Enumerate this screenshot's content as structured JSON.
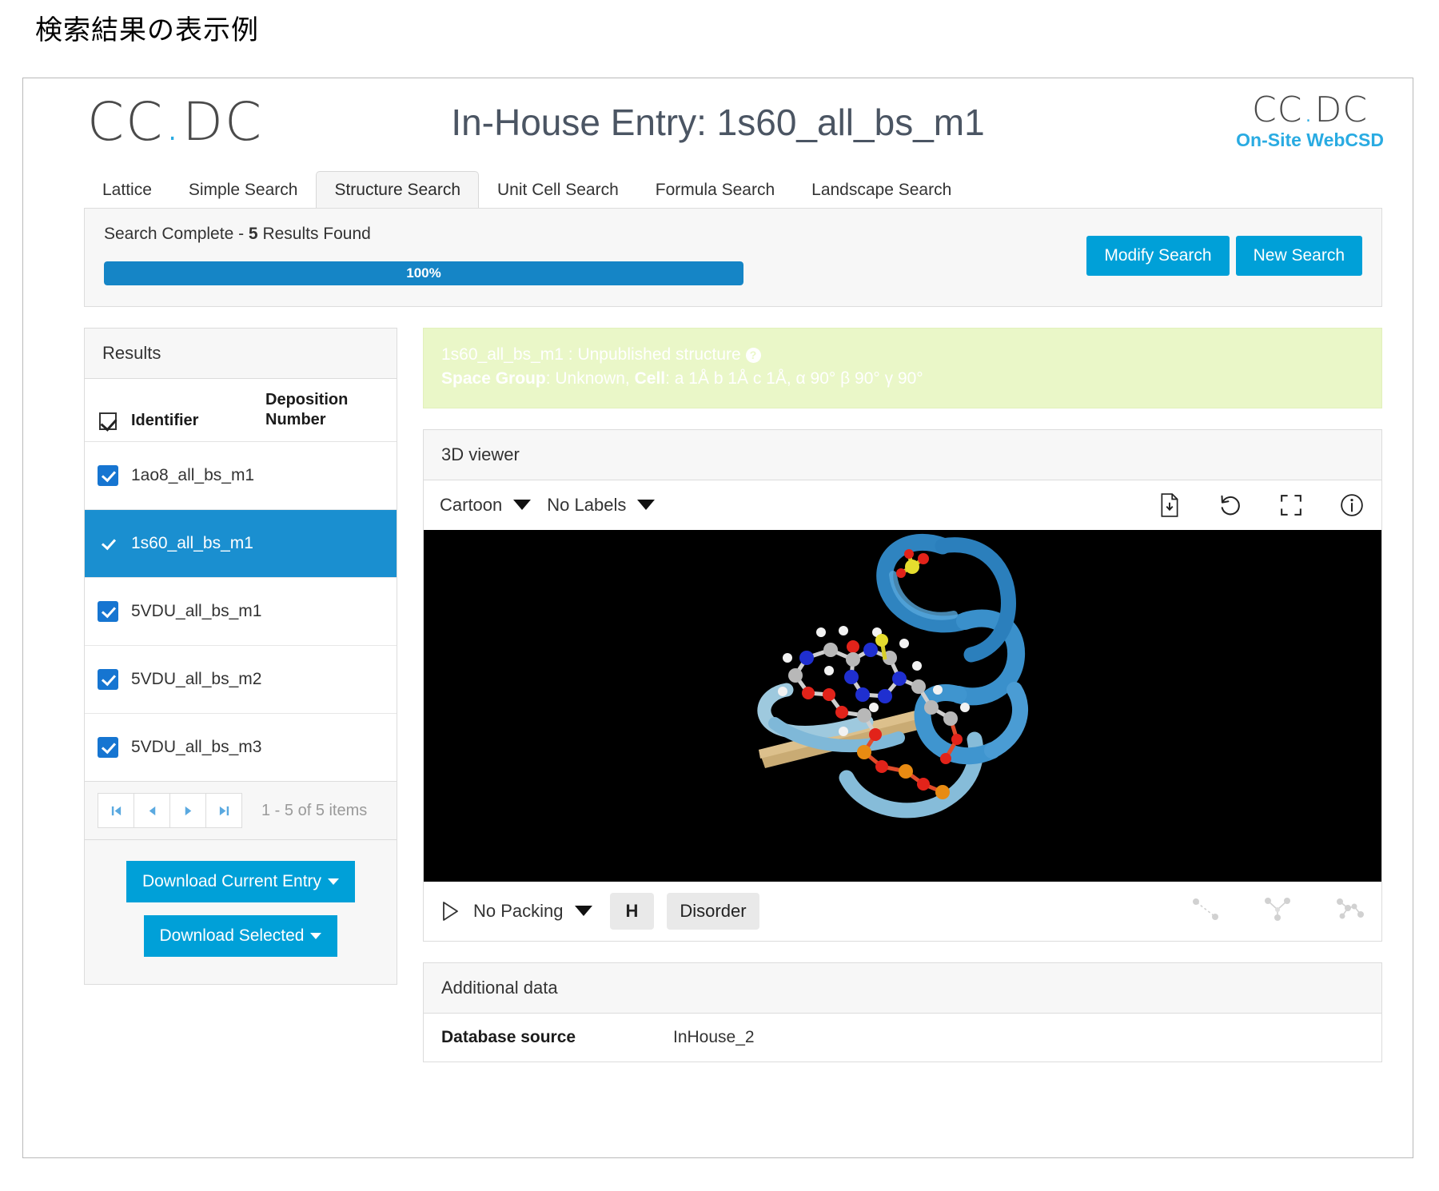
{
  "caption": "検索結果の表示例",
  "header": {
    "logo_left": "CCDC",
    "title": "In-House Entry: 1s60_all_bs_m1",
    "logo_right_top": "CCDC",
    "logo_right_sub": "On-Site WebCSD",
    "accent_color": "#29abe2"
  },
  "tabs": [
    {
      "label": "Lattice",
      "active": false
    },
    {
      "label": "Simple Search",
      "active": false
    },
    {
      "label": "Structure Search",
      "active": true
    },
    {
      "label": "Unit Cell Search",
      "active": false
    },
    {
      "label": "Formula Search",
      "active": false
    },
    {
      "label": "Landscape Search",
      "active": false
    }
  ],
  "status": {
    "prefix": "Search Complete - ",
    "count": "5",
    "suffix": " Results Found",
    "progress_label": "100%",
    "progress_percent": 100,
    "modify_button": "Modify Search",
    "new_button": "New Search",
    "button_color": "#00a0d8",
    "progress_color": "#1585c6"
  },
  "results": {
    "panel_title": "Results",
    "columns": [
      "Identifier",
      "Deposition Number"
    ],
    "rows": [
      {
        "identifier": "1ao8_all_bs_m1",
        "deposition": "",
        "checked": true,
        "selected": false
      },
      {
        "identifier": "1s60_all_bs_m1",
        "deposition": "",
        "checked": true,
        "selected": true
      },
      {
        "identifier": "5VDU_all_bs_m1",
        "deposition": "",
        "checked": true,
        "selected": false
      },
      {
        "identifier": "5VDU_all_bs_m2",
        "deposition": "",
        "checked": true,
        "selected": false
      },
      {
        "identifier": "5VDU_all_bs_m3",
        "deposition": "",
        "checked": true,
        "selected": false
      }
    ],
    "pager": {
      "first": "first-page-icon",
      "prev": "previous-page-icon",
      "next": "next-page-icon",
      "last": "last-page-icon",
      "info": "1 - 5 of 5 items"
    },
    "download_current": "Download Current Entry",
    "download_selected": "Download Selected",
    "selected_row_color": "#1a8fd0",
    "checkbox_color": "#1675d1"
  },
  "notice": {
    "entry_id": "1s60_all_bs_m1",
    "separator": " : ",
    "status_text": "Unpublished structure",
    "help_icon": "help-circle-icon",
    "space_group_label": "Space Group",
    "space_group_value": ": Unknown, ",
    "cell_label": "Cell",
    "cell_value": ": a 1Å b 1Å c 1Å, α 90° β 90° γ 90°",
    "background_color": "#eaf7c8"
  },
  "viewer": {
    "panel_title": "3D viewer",
    "style_dropdown": "Cartoon",
    "labels_dropdown": "No Labels",
    "toolbar_icons": [
      "file-download-icon",
      "reset-view-icon",
      "fullscreen-icon",
      "info-icon"
    ],
    "packing_dropdown": "No Packing",
    "hydrogen_button": "H",
    "disorder_button": "Disorder",
    "play_icon": "play-icon",
    "measure_icons": [
      "measure-distance-icon",
      "measure-angle-icon",
      "measure-torsion-icon"
    ],
    "canvas_background": "#000000"
  },
  "additional_data": {
    "panel_title": "Additional data",
    "rows": [
      {
        "key": "Database source",
        "value": "InHouse_2"
      }
    ]
  }
}
